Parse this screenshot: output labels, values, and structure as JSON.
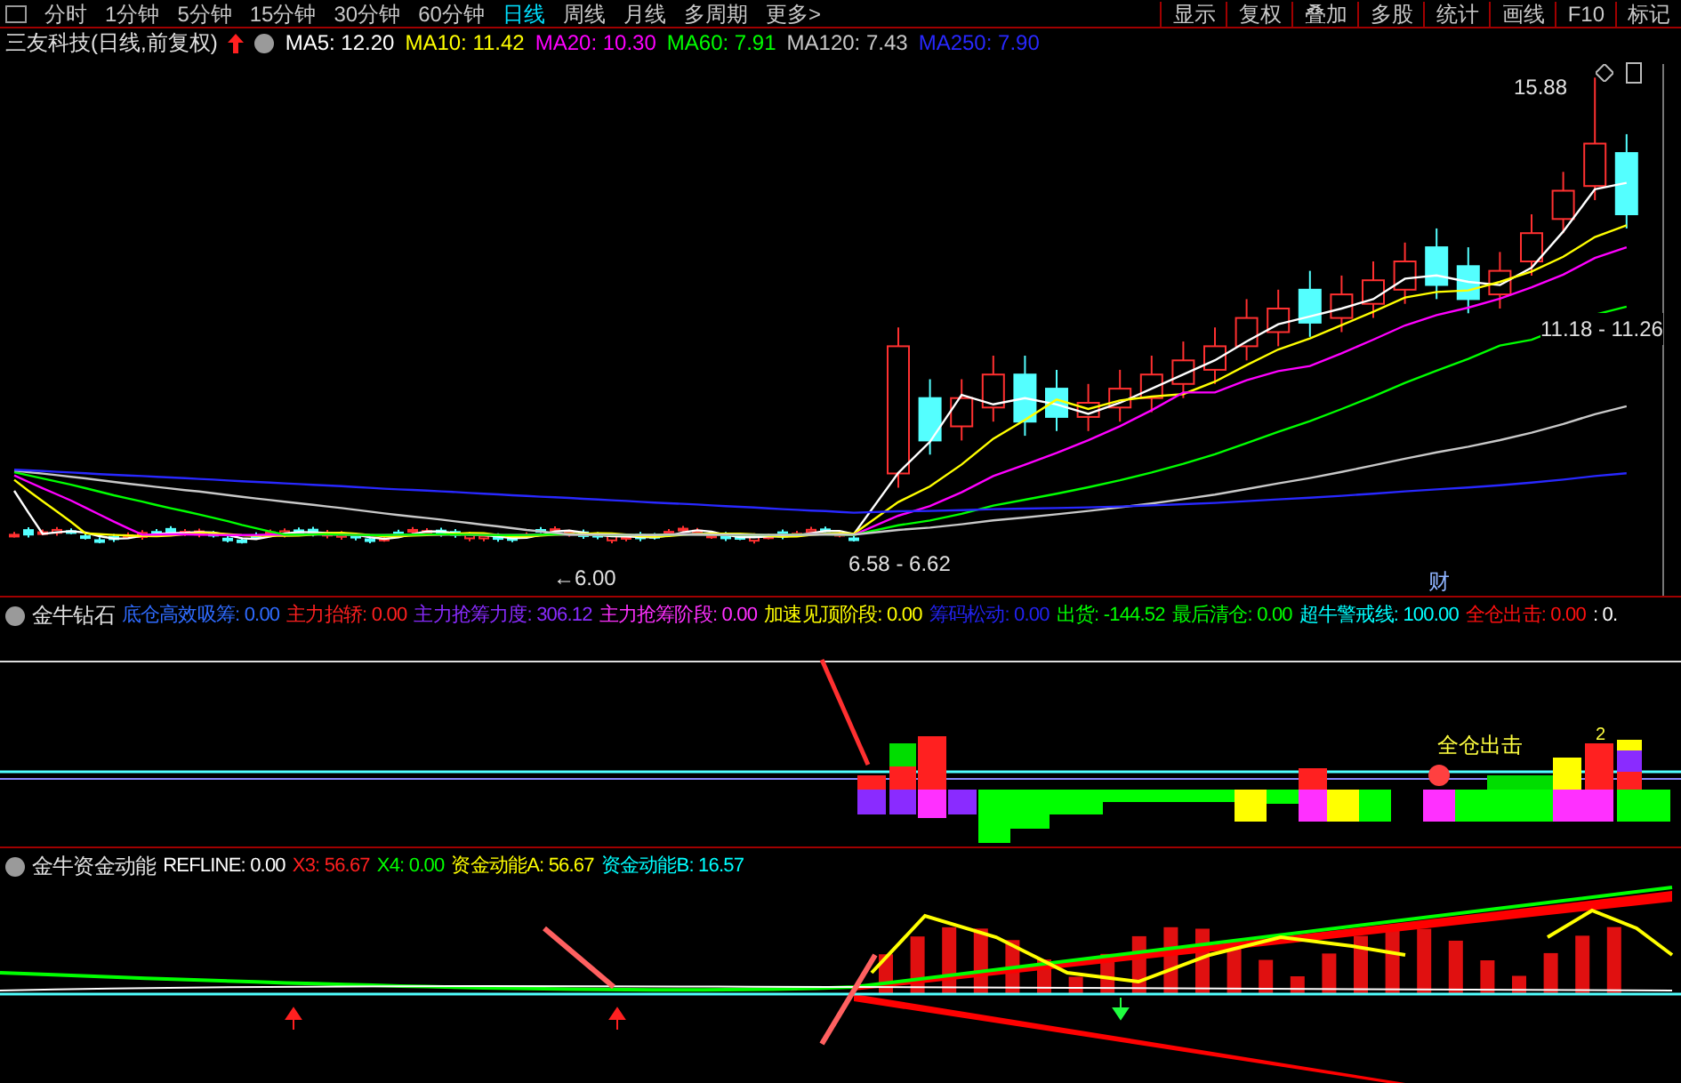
{
  "period_tabs": [
    {
      "label": "分时",
      "selected": false
    },
    {
      "label": "1分钟",
      "selected": false
    },
    {
      "label": "5分钟",
      "selected": false
    },
    {
      "label": "15分钟",
      "selected": false
    },
    {
      "label": "30分钟",
      "selected": false
    },
    {
      "label": "60分钟",
      "selected": false
    },
    {
      "label": "日线",
      "selected": true
    },
    {
      "label": "周线",
      "selected": false
    },
    {
      "label": "月线",
      "selected": false
    },
    {
      "label": "多周期",
      "selected": false
    },
    {
      "label": "更多>",
      "selected": false
    }
  ],
  "toolbar_buttons": [
    "显示",
    "复权",
    "叠加",
    "多股",
    "统计",
    "画线",
    "F10",
    "标记"
  ],
  "main_chart": {
    "title": "三友科技(日线,前复权)",
    "indicators": [
      {
        "label": "MA5: 12.20",
        "color": "#ffffff"
      },
      {
        "label": "MA10: 11.42",
        "color": "#ffff00"
      },
      {
        "label": "MA20: 10.30",
        "color": "#ff00ff"
      },
      {
        "label": "MA60: 7.91",
        "color": "#00ff00"
      },
      {
        "label": "MA120: 7.43",
        "color": "#c8c8c8"
      },
      {
        "label": "MA250: 7.90",
        "color": "#2828ff"
      }
    ],
    "high_label": "15.88",
    "range_high": "11.18 - 11.26",
    "range_low": "6.58 - 6.62",
    "low_label": "←6.00",
    "event_mark": "财"
  },
  "indicator_1": {
    "title": "金牛钻石",
    "values": [
      {
        "label": "底仓高效吸筹: 0.00",
        "color": "#2f6bff"
      },
      {
        "label": "主力抬轿: 0.00",
        "color": "#ff2020"
      },
      {
        "label": "主力抢筹力度: 306.12",
        "color": "#8a2bff"
      },
      {
        "label": "主力抢筹阶段: 0.00",
        "color": "#ff30ff"
      },
      {
        "label": "加速见顶阶段: 0.00",
        "color": "#ffff00"
      },
      {
        "label": "筹码松动: 0.00",
        "color": "#2222ee"
      },
      {
        "label": "出货: -144.52",
        "color": "#00ff00"
      },
      {
        "label": "最后清仓: 0.00",
        "color": "#00ff00"
      },
      {
        "label": "超牛警戒线: 100.00",
        "color": "#00ffff"
      },
      {
        "label": "全仓出击: 0.00",
        "color": "#ff1010"
      },
      {
        "label": ": 0.",
        "color": "#ffffff"
      }
    ],
    "signal_label": "全仓出击",
    "count_label": "2"
  },
  "indicator_2": {
    "title": "金牛资金动能",
    "values": [
      {
        "label": "REFLINE: 0.00",
        "color": "#ffffff"
      },
      {
        "label": "X3: 56.67",
        "color": "#ff2020"
      },
      {
        "label": "X4: 0.00",
        "color": "#00ff00"
      },
      {
        "label": "资金动能A: 56.67",
        "color": "#ffff00"
      },
      {
        "label": "资金动能B: 16.57",
        "color": "#00ffff"
      }
    ]
  }
}
